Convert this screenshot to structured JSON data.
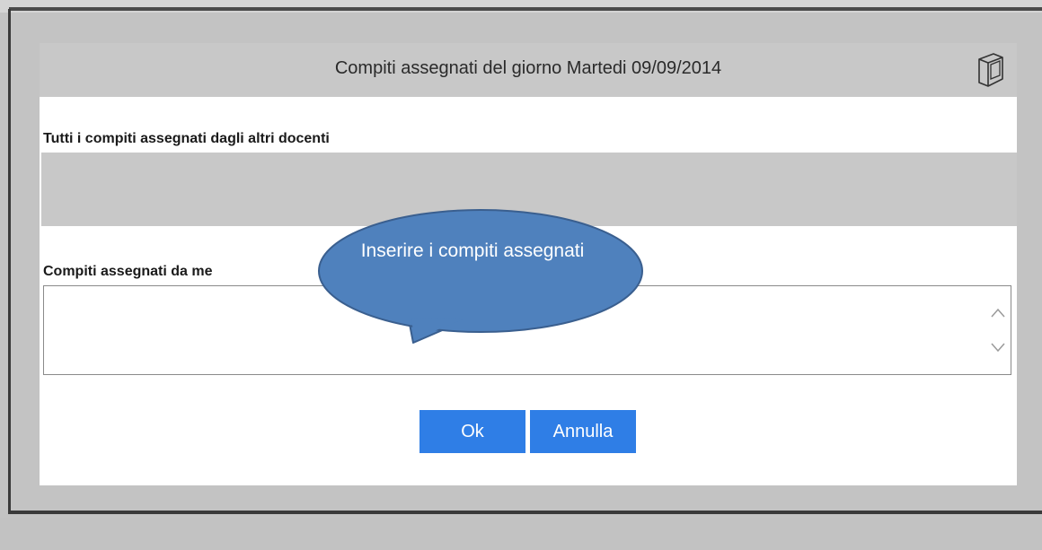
{
  "dialog": {
    "title": "Compiti assegnati del giorno Martedi 09/09/2014",
    "others_label": "Tutti i compiti assegnati dagli altri docenti",
    "mine_label": "Compiti assegnati da me",
    "mine_value": "",
    "ok_label": "Ok",
    "cancel_label": "Annulla"
  },
  "callout": {
    "text": "Inserire i compiti assegnati"
  },
  "icons": {
    "header_icon": "book-icon",
    "scroll_up": "chevron-up-icon",
    "scroll_down": "chevron-down-icon"
  },
  "colors": {
    "button": "#2f7ee6",
    "header_bg": "#c8c8c8",
    "callout_fill": "#4f81bd",
    "callout_stroke": "#3a5f8f"
  }
}
